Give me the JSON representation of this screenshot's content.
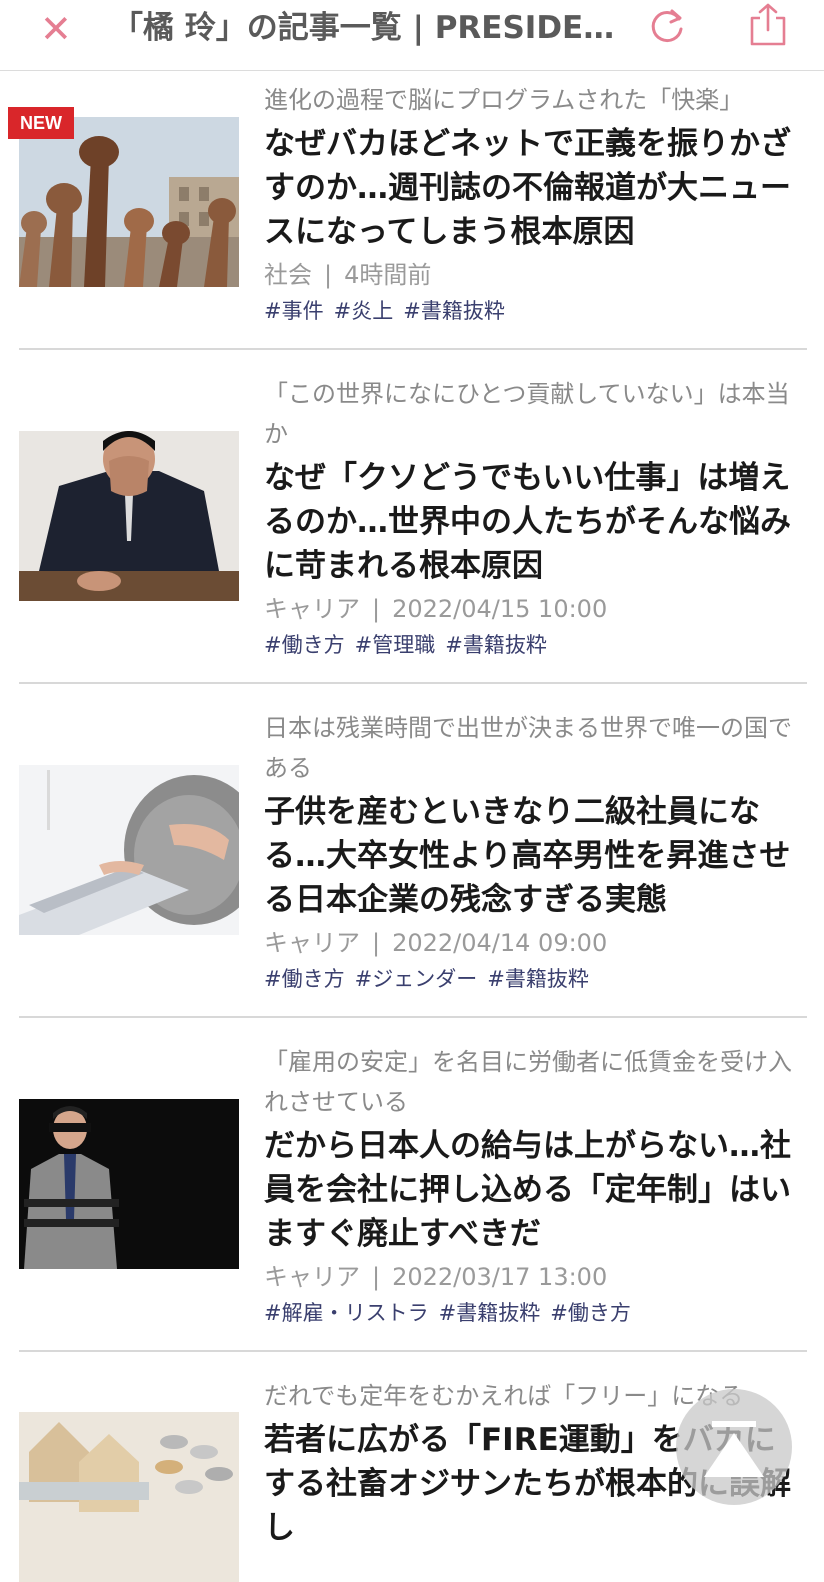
{
  "header": {
    "close_glyph": "✕",
    "title": "「橘 玲」の記事一覧 | PRESIDE…"
  },
  "articles": [
    {
      "badge": "NEW",
      "lead": "進化の過程で脳にプログラムされた「快楽」",
      "headline": "なぜバカほどネットで正義を振りかざすのか…週刊誌の不倫報道が大ニュースになってしまう根本原因",
      "category": "社会",
      "date": "4時間前",
      "tags": [
        "#事件",
        "#炎上",
        "#書籍抜粋"
      ]
    },
    {
      "lead": "「この世界になにひとつ貢献していない」は本当か",
      "headline": "なぜ「クソどうでもいい仕事」は増えるのか…世界中の人たちがそんな悩みに苛まれる根本原因",
      "category": "キャリア",
      "date": "2022/04/15 10:00",
      "tags": [
        "#働き方",
        "#管理職",
        "#書籍抜粋"
      ]
    },
    {
      "lead": "日本は残業時間で出世が決まる世界で唯一の国である",
      "headline": "子供を産むといきなり二級社員になる…大卒女性より高卒男性を昇進させる日本企業の残念すぎる実態",
      "category": "キャリア",
      "date": "2022/04/14 09:00",
      "tags": [
        "#働き方",
        "#ジェンダー",
        "#書籍抜粋"
      ]
    },
    {
      "lead": "「雇用の安定」を名目に労働者に低賃金を受け入れさせている",
      "headline": "だから日本人の給与は上がらない…社員を会社に押し込める「定年制」はいますぐ廃止すべきだ",
      "category": "キャリア",
      "date": "2022/03/17 13:00",
      "tags": [
        "#解雇・リストラ",
        "#書籍抜粋",
        "#働き方"
      ]
    },
    {
      "lead": "だれでも定年をむかえれば「フリー」になる",
      "headline": "若者に広がる「FIRE運動」をバカにする社畜オジサンたちが根本的に誤解し"
    }
  ],
  "colors": {
    "accent": "#e57e92",
    "new_badge": "#d9262a",
    "tag": "#3a3f6e"
  },
  "icons": [
    "close-icon",
    "reload-icon",
    "share-icon",
    "scroll-top-icon"
  ]
}
